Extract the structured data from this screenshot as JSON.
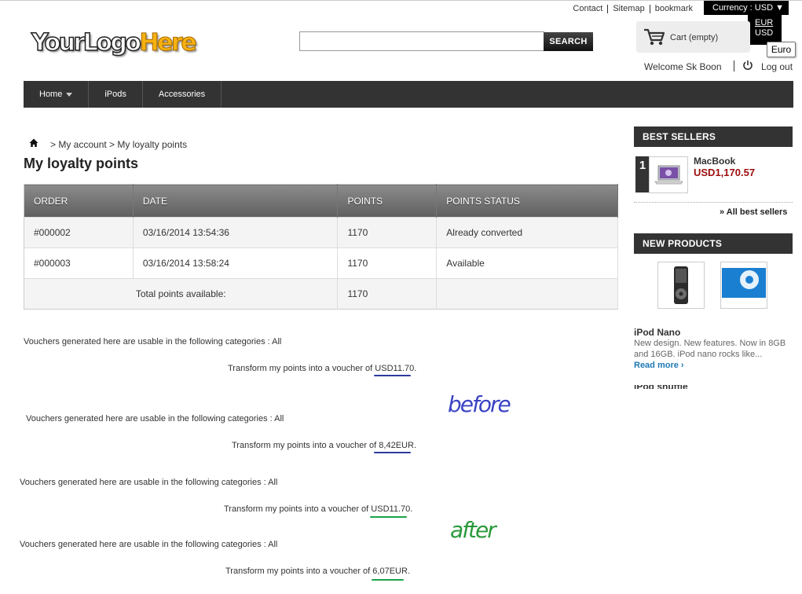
{
  "header": {
    "top_links": [
      "Contact",
      "Sitemap",
      "bookmark"
    ],
    "currency_label": "Currency : USD",
    "currency_options": [
      "EUR",
      "USD"
    ],
    "tooltip": "Euro",
    "logo": {
      "part1": "YourLogo",
      "part2": "Here"
    },
    "search": {
      "placeholder": "",
      "button_label": "SEARCH"
    },
    "cart_label": "Cart (empty)",
    "welcome": "Welcome Sk Boon",
    "logout": "Log out"
  },
  "nav": {
    "items": [
      "Home",
      "iPods",
      "Accessories"
    ]
  },
  "breadcrumb": {
    "text": "> My account > My loyalty points"
  },
  "page_title": "My loyalty points",
  "table": {
    "headers": [
      "ORDER",
      "DATE",
      "POINTS",
      "POINTS STATUS"
    ],
    "rows": [
      [
        "#000002",
        "03/16/2014 13:54:36",
        "1170",
        "Already converted"
      ],
      [
        "#000003",
        "03/16/2014 13:58:24",
        "1170",
        "Available"
      ]
    ],
    "total_label": "Total points available:",
    "total_value": "1170"
  },
  "vouchers": {
    "categories_text": "Vouchers generated here are usable in the following categories : All",
    "transform_prefix": "Transform my points into a voucher of",
    "before_usd": "USD11.70",
    "before_eur": "8,42EUR",
    "after_usd": "USD11.70",
    "after_eur": "6,07EUR"
  },
  "annotations": {
    "before": "before",
    "after": "after"
  },
  "sidebar": {
    "best_sellers_title": "BEST SELLERS",
    "best_sellers": [
      {
        "rank": "1",
        "name": "MacBook",
        "price": "USD1,170.57"
      }
    ],
    "all_best_sellers": "» All best sellers",
    "new_products_title": "NEW PRODUCTS",
    "new_product": {
      "name": "iPod Nano",
      "description": "New design. New features. Now in 8GB and 16GB. iPod nano rocks like...",
      "read_more": "Read more"
    }
  }
}
